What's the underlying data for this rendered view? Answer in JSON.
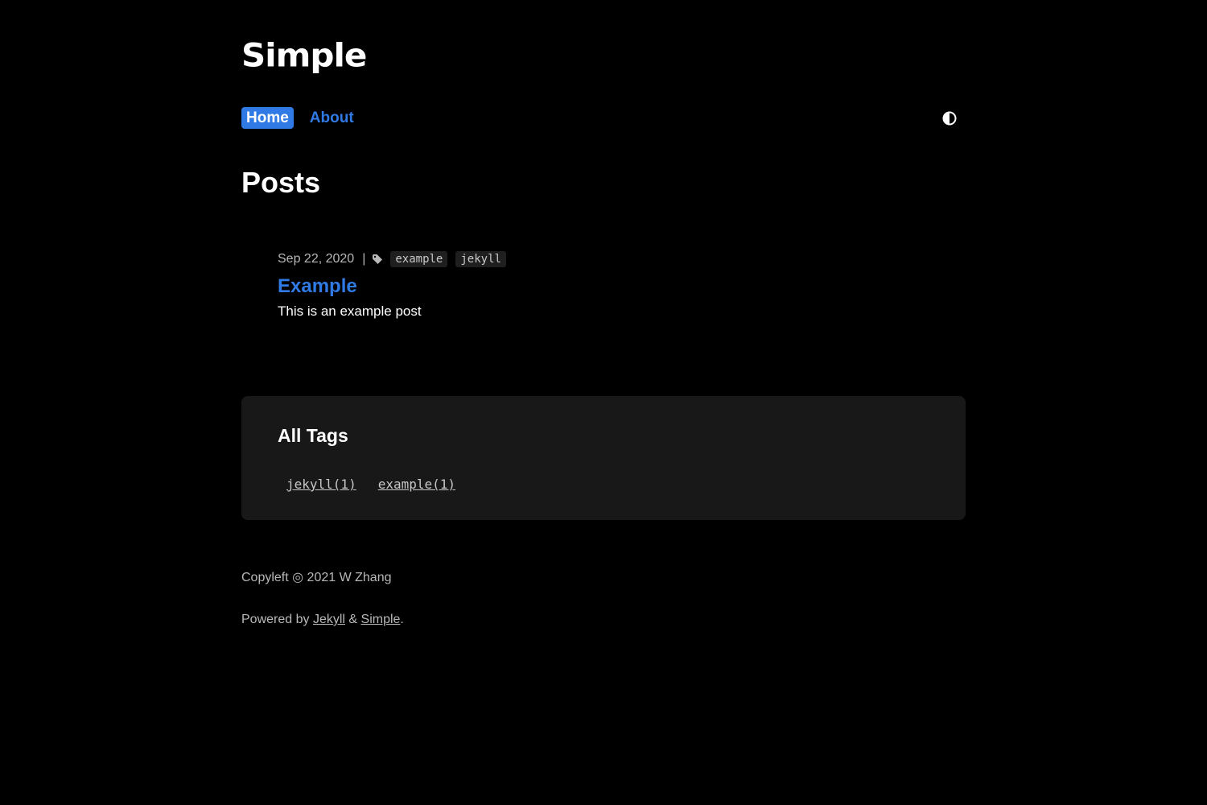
{
  "site": {
    "logo": "Simple"
  },
  "nav": {
    "items": [
      {
        "label": "Home",
        "active": true
      },
      {
        "label": "About",
        "active": false
      }
    ],
    "theme_toggle_icon": "contrast-icon"
  },
  "page": {
    "title": "Posts"
  },
  "posts": [
    {
      "date": "Sep 22, 2020",
      "separator": "|",
      "tags": [
        "example",
        "jekyll"
      ],
      "title": "Example",
      "excerpt": "This is an example post"
    }
  ],
  "all_tags": {
    "heading": "All Tags",
    "items": [
      "jekyll(1)",
      "example(1)"
    ]
  },
  "footer": {
    "copyright": "Copyleft ◎ 2021 W Zhang",
    "powered_prefix": "Powered by ",
    "jekyll_link": "Jekyll",
    "amp": " & ",
    "simple_link": "Simple",
    "suffix": "."
  },
  "colors": {
    "accent": "#2f7ae5",
    "background": "#000000",
    "panel": "#181818",
    "muted_text": "#b8b8b8"
  }
}
